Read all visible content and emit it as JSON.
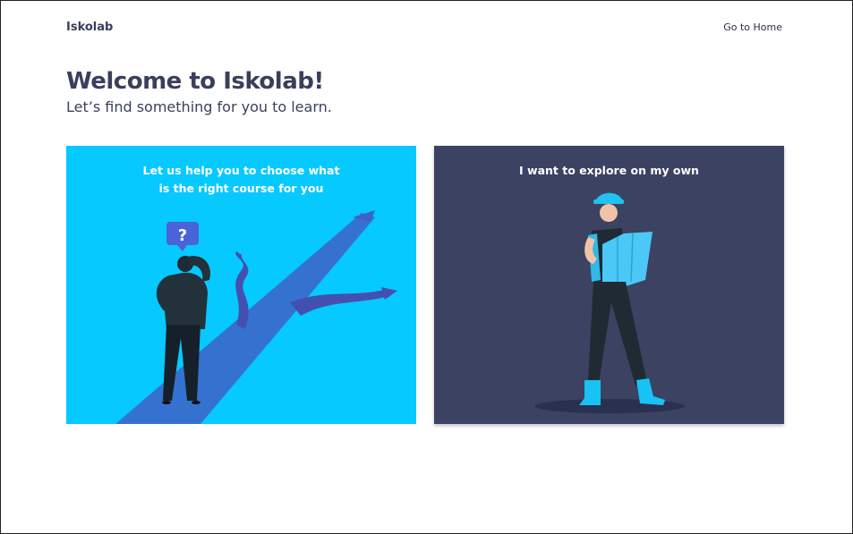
{
  "header": {
    "brand": "Iskolab",
    "home_link": "Go to Home"
  },
  "hero": {
    "title": "Welcome to Iskolab!",
    "subtitle": "Let’s find something for you to learn."
  },
  "cards": [
    {
      "title_lines": [
        "Let us help you to choose what",
        "is the right course for you"
      ],
      "illustration": "person-at-crossroads-illustration",
      "background": "#06c9ff"
    },
    {
      "title_lines": [
        "I want to explore on my own"
      ],
      "illustration": "explorer-with-map-illustration",
      "background": "#3b4262"
    }
  ],
  "colors": {
    "text_dark": "#3a3f5c",
    "accent_cyan": "#06c9ff",
    "card_navy": "#3b4262"
  }
}
